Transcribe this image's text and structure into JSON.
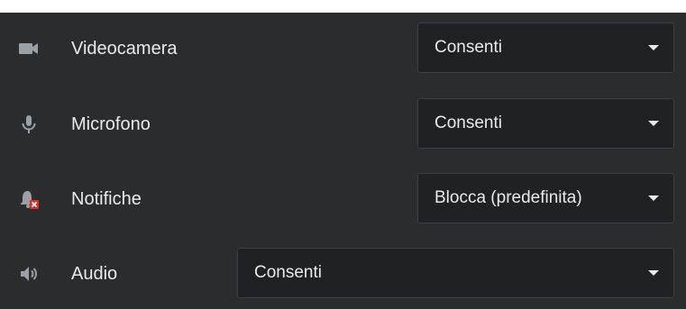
{
  "colors": {
    "panel_bg": "#2b2c2e",
    "select_bg": "#202124",
    "text": "#e8eaed",
    "icon": "#9aa0a6",
    "block_badge": "#d93025"
  },
  "permissions": [
    {
      "icon": "videocam-icon",
      "label": "Videocamera",
      "value": "Consenti"
    },
    {
      "icon": "microphone-icon",
      "label": "Microfono",
      "value": "Consenti"
    },
    {
      "icon": "notifications-blocked-icon",
      "label": "Notifiche",
      "value": "Blocca (predefinita)"
    },
    {
      "icon": "volume-icon",
      "label": "Audio",
      "value": "Consenti"
    }
  ]
}
